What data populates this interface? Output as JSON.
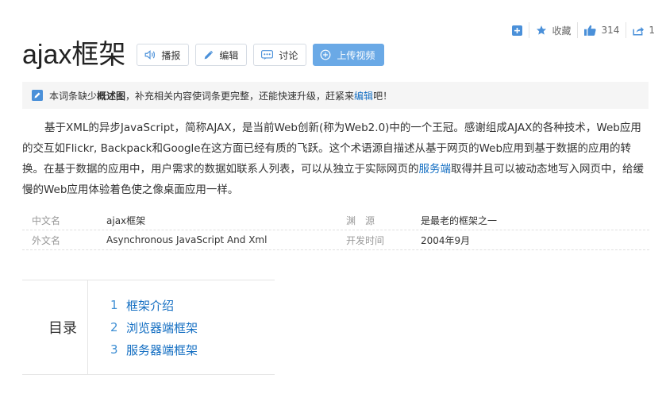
{
  "toolbar": {
    "favorite_label": "收藏",
    "like_count": "314",
    "share_count": "1"
  },
  "title": "ajax框架",
  "actions": {
    "broadcast": "播报",
    "edit": "编辑",
    "discuss": "讨论",
    "upload": "上传视频"
  },
  "notice": {
    "prefix": "本词条缺少",
    "bold": "概述图",
    "middle": "，补充相关内容使词条更完整，还能快速升级，赶紧来",
    "link": "编辑",
    "suffix": "吧！"
  },
  "summary": {
    "part1": "基于XML的异步JavaScript，简称AJAX，是当前Web创新(称为Web2.0)中的一个王冠。感谢组成AJAX的各种技术，Web应用的交互如Flickr, Backpack和Google在这方面已经有质的飞跃。这个术语源自描述从基于网页的Web应用到基于数据的应用的转换。在基于数据的应用中，用户需求的数据如联系人列表，可以从独立于实际网页的",
    "link": "服务端",
    "part2": "取得并且可以被动态地写入网页中，给缓慢的Web应用体验着色使之像桌面应用一样。"
  },
  "info": [
    {
      "label": "中文名",
      "value": "ajax框架",
      "label2": "渊　源",
      "value2": "是最老的框架之一"
    },
    {
      "label": "外文名",
      "value": "Asynchronous JavaScript And Xml",
      "label2": "开发时间",
      "value2": "2004年9月"
    }
  ],
  "toc": {
    "title": "目录",
    "items": [
      {
        "num": "1",
        "label": "框架介绍"
      },
      {
        "num": "2",
        "label": "浏览器端框架"
      },
      {
        "num": "3",
        "label": "服务器端框架"
      }
    ]
  },
  "colors": {
    "link": "#136ec2",
    "upload_button": "#6aa9e6",
    "icon_blue": "#4a90d9"
  }
}
